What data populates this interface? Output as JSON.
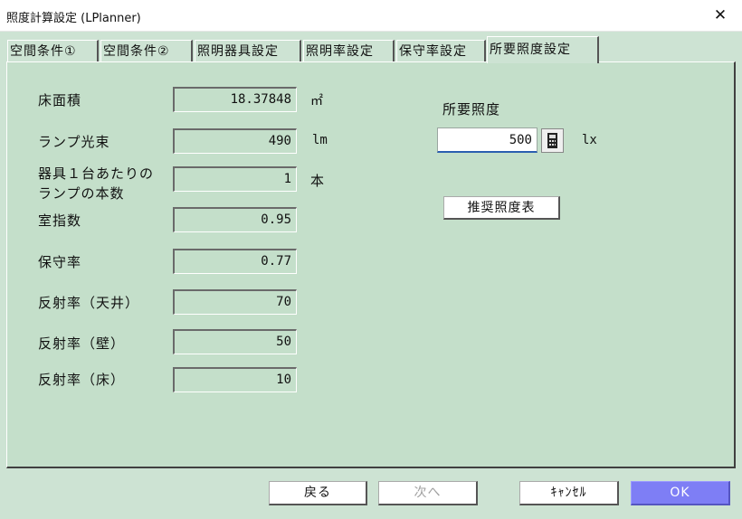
{
  "window": {
    "title": "照度計算設定 (LPlanner)"
  },
  "tabs": [
    {
      "label": "空間条件①",
      "active": false
    },
    {
      "label": "空間条件②",
      "active": false
    },
    {
      "label": "照明器具設定",
      "active": false
    },
    {
      "label": "照明率設定",
      "active": false
    },
    {
      "label": "保守率設定",
      "active": false
    },
    {
      "label": "所要照度設定",
      "active": true
    }
  ],
  "fields": [
    {
      "label": "床面積",
      "value": "18.37848",
      "unit": "㎡"
    },
    {
      "label": "ランプ光束",
      "value": "490",
      "unit": "lm"
    },
    {
      "label": "器具１台あたりの\nランプの本数",
      "value": "1",
      "unit": "本"
    },
    {
      "label": "室指数",
      "value": "0.95",
      "unit": ""
    },
    {
      "label": "保守率",
      "value": "0.77",
      "unit": ""
    },
    {
      "label": "反射率（天井）",
      "value": "70",
      "unit": ""
    },
    {
      "label": "反射率（壁）",
      "value": "50",
      "unit": ""
    },
    {
      "label": "反射率（床）",
      "value": "10",
      "unit": ""
    }
  ],
  "required": {
    "label": "所要照度",
    "value": "500",
    "unit": "lx",
    "recommend_button": "推奨照度表"
  },
  "footer": {
    "back": "戻る",
    "next": "次へ",
    "cancel": "ｷｬﾝｾﾙ",
    "ok": "OK"
  },
  "icons": {
    "close": "close-icon",
    "calculator": "calculator-icon"
  },
  "colors": {
    "background": "#cde3d3",
    "ok_button": "#7e7ef5",
    "input_underline": "#2a5fb0"
  }
}
